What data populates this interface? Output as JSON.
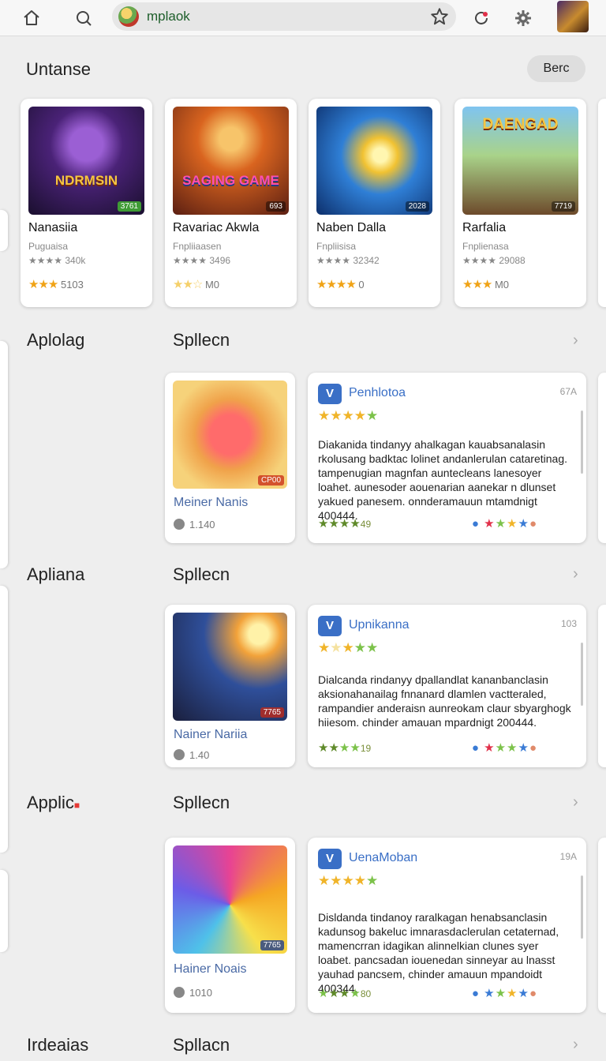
{
  "toolbar": {
    "search_query": "mplaok",
    "icons": [
      "home-icon",
      "search-icon",
      "star-icon",
      "refresh-icon",
      "settings-icon",
      "profile-avatar"
    ]
  },
  "featured": {
    "title": "Untanse",
    "button_label": "Berc",
    "cards": [
      {
        "name": "Nanasiia",
        "sub": "Puguaisa",
        "rating": "★★★★ 340k",
        "meta_count": "5103",
        "badge": "3761",
        "banner": "NDRMSIN",
        "art": "purple"
      },
      {
        "name": "Ravariac Akwla",
        "sub": "Fnpliiaasen",
        "rating": "★★★★ 3496",
        "meta_count": "M0",
        "badge": "693",
        "banner": "SAGING GAME",
        "art": "orange"
      },
      {
        "name": "Naben Dalla",
        "sub": "Fnpliisisa",
        "rating": "★★★★ 32342",
        "meta_count": "0",
        "badge": "2028",
        "banner": "",
        "art": "blue"
      },
      {
        "name": "Rarfalia",
        "sub": "Fnplienasa",
        "rating": "★★★★ 29088",
        "meta_count": "M0",
        "badge": "7719",
        "banner": "DAENGAD",
        "art": "green"
      }
    ]
  },
  "sections": [
    {
      "left_label": "Aplolag",
      "title": "Spllecn",
      "app": {
        "name": "Meiner Nanis",
        "downloads": "1.140",
        "badge": "CP00",
        "art": "clown-red"
      },
      "review": {
        "name": "Penhlotoa",
        "count": "67A",
        "text": "Diakanida tindanyy ahalkagan kauabsanalasin rkolusang badktac lolinet andanlerulan cataretinag. tampenugian magnfan auntecleans lanesoyer loahet. aunesoder aouenarian aanekar n dlunset yakued panesem. onnderamauun mtamdnigt 400444.",
        "foot_num": "49"
      }
    },
    {
      "left_label": "Apliana",
      "title": "Spllecn",
      "app": {
        "name": "Nainer Nariia",
        "downloads": "1.40",
        "badge": "7765",
        "art": "warrior"
      },
      "review": {
        "name": "Upnikanna",
        "count": "103",
        "text": "Dialcanda rindanyy dpallandlat kananbanclasin aksionahanailag fnnanard dlamlen vactteraled, rampandier anderaisn aunreokam claur sbyarghogk hiiesom. chinder amauan mpardnigt 200444.",
        "foot_num": "19"
      }
    },
    {
      "left_label": "Applic",
      "title": "Spllecn",
      "app": {
        "name": "Hainer Noais",
        "downloads": "1010",
        "badge": "7765",
        "art": "clown-blue"
      },
      "review": {
        "name": "UenaMoban",
        "count": "19A",
        "text": "Disldanda tindanoy raralkagan henabsanclasin kadunsog bakeluc imnarasdaclerulan cetaternad, mamencrran idagikan alinnelkian clunes syer loabet. pancsadan iouenedan sinneyar au lnasst yauhad pancsem, chinder amauun mpandoidt 400344.",
        "foot_num": "80"
      }
    },
    {
      "left_label": "Irdeaias",
      "title": "Spllacn"
    }
  ],
  "colors": {
    "accent": "#3a6fc6",
    "star": "#f0b429",
    "star_green": "#7cc24a"
  }
}
